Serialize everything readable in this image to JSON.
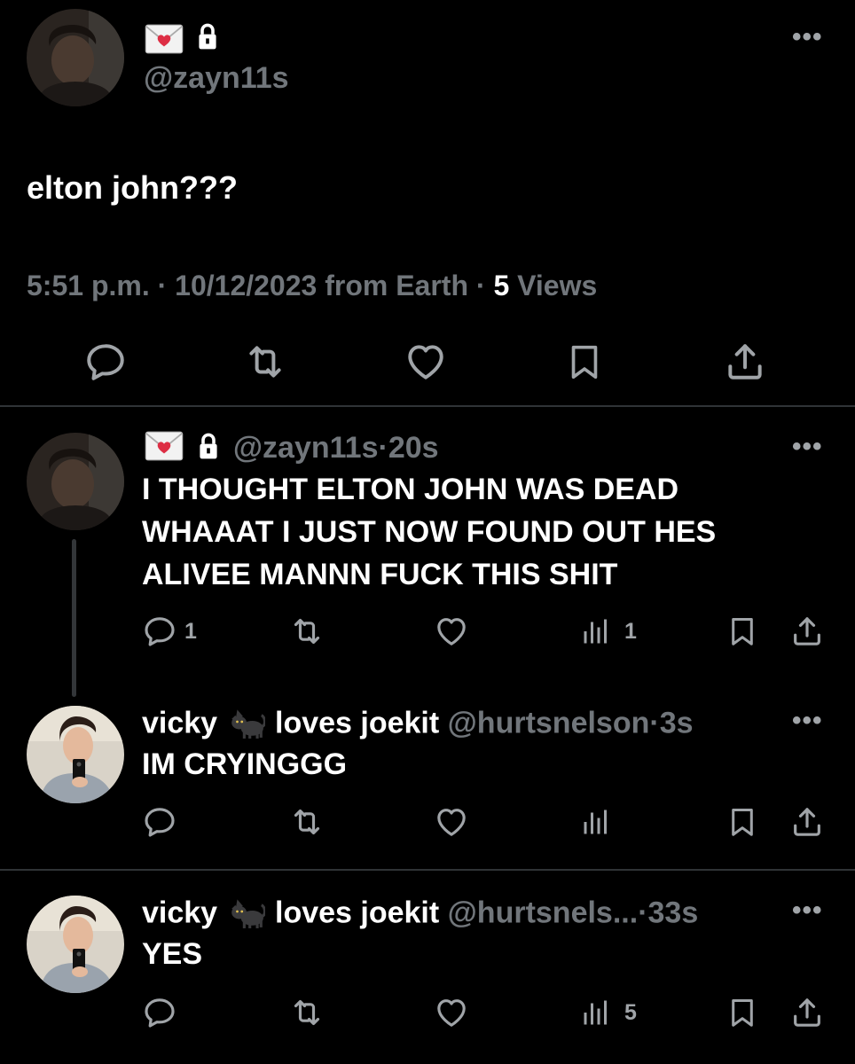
{
  "main_tweet": {
    "handle": "@zayn11s",
    "text": "elton john???",
    "time": "5:51 p.m.",
    "sep1": "·",
    "date": "10/12/2023 from Earth",
    "sep2": "·",
    "views_count": "5",
    "views_label": "Views",
    "more_label": "•••"
  },
  "reply1": {
    "handle": "@zayn11s",
    "dot": "·",
    "age": "20s",
    "text_line1": "I THOUGHT ELTON JOHN WAS DEAD",
    "text_line2": "WHAAAT I JUST NOW FOUND OUT HES",
    "text_line3": "ALIVEE MANNN FUCK THIS SHIT",
    "reply_count": "1",
    "views_count": "1",
    "more_label": "•••"
  },
  "reply2": {
    "name_a": "vicky",
    "name_b": "loves joekit",
    "handle": "@hurtsnelson",
    "dot": "·",
    "age": "3s",
    "text": "IM CRYINGGG",
    "more_label": "•••"
  },
  "reply3": {
    "name_a": "vicky",
    "name_b": "loves joekit",
    "handle": "@hurtsnels...",
    "dot": "·",
    "age": "33s",
    "text": "YES",
    "views_count": "5",
    "more_label": "•••"
  },
  "icons": {
    "reply": "reply-icon",
    "retweet": "retweet-icon",
    "like": "heart-icon",
    "bookmark": "bookmark-icon",
    "share": "share-icon",
    "views": "views-icon",
    "envelope_emoji": "love-letter-emoji",
    "lock": "lock-icon",
    "cat_emoji": "black-cat-emoji"
  },
  "colors": {
    "background": "#000000",
    "text": "#e7e9ea",
    "muted": "#71767b",
    "divider": "#2f3336"
  }
}
